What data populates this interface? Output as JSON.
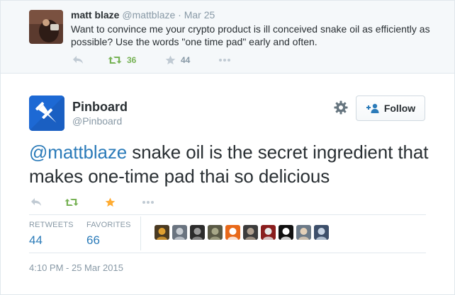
{
  "parent_tweet": {
    "name": "matt blaze",
    "handle": "@mattblaze",
    "separator": "·",
    "date": "Mar 25",
    "text": "Want to convince me your crypto product is ill conceived snake oil as efficiently as possible? Use the words \"one time pad\" early and often.",
    "retweets": "36",
    "favorites": "44"
  },
  "tweet": {
    "name": "Pinboard",
    "handle": "@Pinboard",
    "mention": "@mattblaze",
    "text": " snake oil is the secret ingredient that makes one-time pad thai so delicious",
    "follow_label": "Follow",
    "retweets_label": "RETWEETS",
    "retweets_count": "44",
    "favorites_label": "FAVORITES",
    "favorites_count": "66",
    "timestamp": "4:10 PM - 25 Mar 2015"
  },
  "colors": {
    "link": "#2b7bb9",
    "retweet_green": "#77b255",
    "favorite_gold": "#ffac33",
    "muted": "#8899a6",
    "brand_blue": "#1d69d4"
  },
  "icons": [
    "reply-icon",
    "retweet-icon",
    "favorite-icon",
    "more-icon",
    "gear-icon",
    "follow-person-icon",
    "pushpin-icon"
  ],
  "favoriter_avatars": [
    {
      "bg": "#4a3a22",
      "fg": "#e0a030"
    },
    {
      "bg": "#6a7480",
      "fg": "#c9ced4"
    },
    {
      "bg": "#2c2c2c",
      "fg": "#9a9a9a"
    },
    {
      "bg": "#5a5a46",
      "fg": "#a8a888"
    },
    {
      "bg": "#e8691a",
      "fg": "#ffffff"
    },
    {
      "bg": "#3c3c3c",
      "fg": "#b0a090"
    },
    {
      "bg": "#8a1e1e",
      "fg": "#e8e8e8"
    },
    {
      "bg": "#111111",
      "fg": "#ffffff"
    },
    {
      "bg": "#6c7a88",
      "fg": "#e4d0b8"
    },
    {
      "bg": "#3d4f6a",
      "fg": "#c8d4e4"
    }
  ]
}
